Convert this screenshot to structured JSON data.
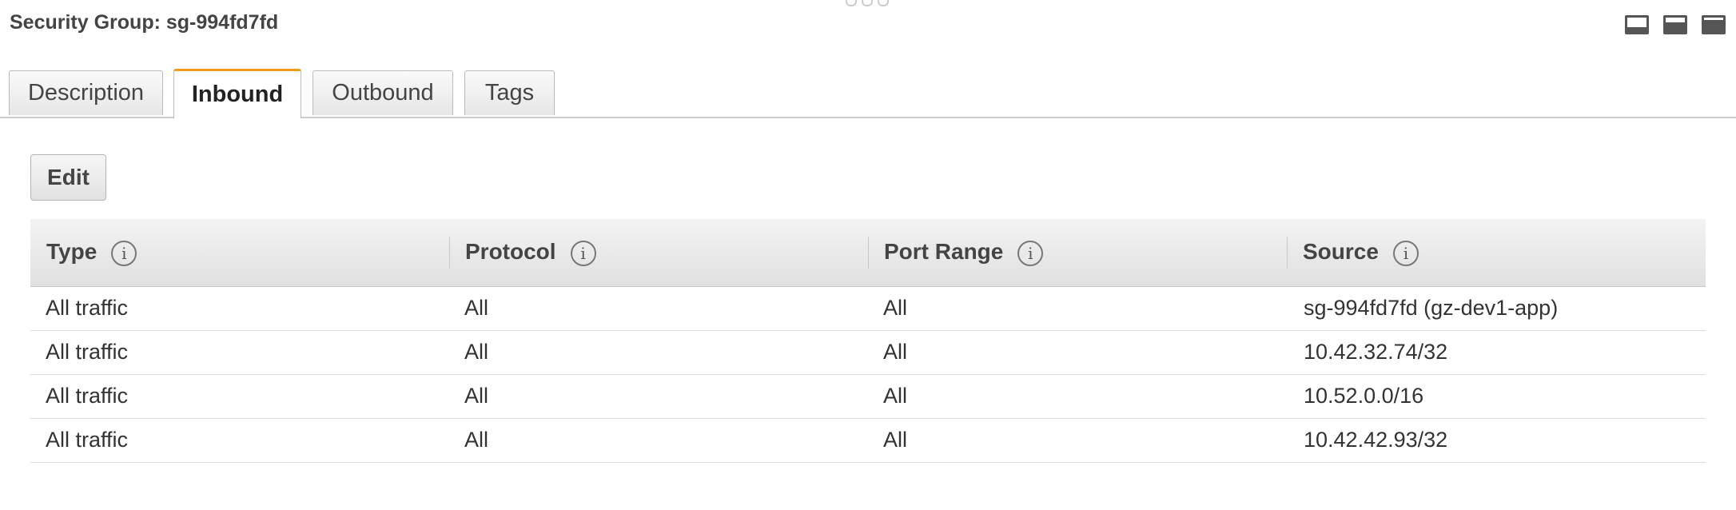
{
  "panel": {
    "title": "Security Group: sg-994fd7fd"
  },
  "tabs": [
    {
      "label": "Description",
      "active": false
    },
    {
      "label": "Inbound",
      "active": true
    },
    {
      "label": "Outbound",
      "active": false
    },
    {
      "label": "Tags",
      "active": false
    }
  ],
  "actions": {
    "edit_label": "Edit"
  },
  "table": {
    "info_glyph": "i",
    "columns": [
      "Type",
      "Protocol",
      "Port Range",
      "Source"
    ],
    "rows": [
      [
        "All traffic",
        "All",
        "All",
        "sg-994fd7fd (gz-dev1-app)"
      ],
      [
        "All traffic",
        "All",
        "All",
        "10.42.32.74/32"
      ],
      [
        "All traffic",
        "All",
        "All",
        "10.52.0.0/16"
      ],
      [
        "All traffic",
        "All",
        "All",
        "10.42.42.93/32"
      ]
    ]
  },
  "colors": {
    "active_tab_accent": "#f29b1d",
    "header_bg": "#e8e8e8",
    "text": "#333333"
  }
}
